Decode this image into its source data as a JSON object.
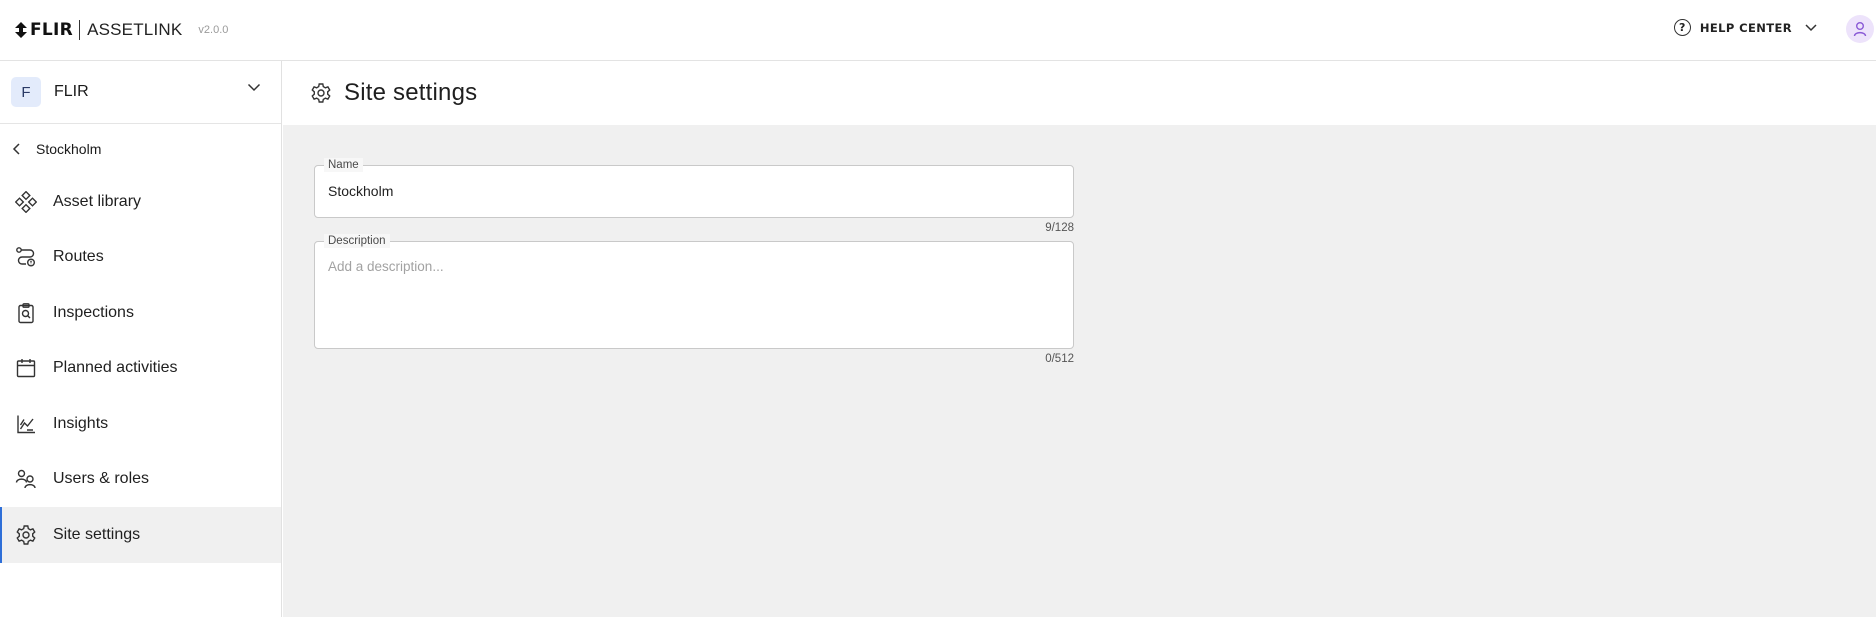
{
  "header": {
    "logo_text": "FLIR",
    "product_name": "ASSETLINK",
    "version": "v2.0.0",
    "help_label": "HELP CENTER"
  },
  "sidebar": {
    "org": {
      "initial": "F",
      "name": "FLIR"
    },
    "back_label": "Stockholm",
    "items": [
      {
        "label": "Asset library",
        "icon": "asset-library-icon",
        "active": false
      },
      {
        "label": "Routes",
        "icon": "routes-icon",
        "active": false
      },
      {
        "label": "Inspections",
        "icon": "inspections-icon",
        "active": false
      },
      {
        "label": "Planned activities",
        "icon": "calendar-icon",
        "active": false
      },
      {
        "label": "Insights",
        "icon": "insights-chart-icon",
        "active": false
      },
      {
        "label": "Users & roles",
        "icon": "users-icon",
        "active": false
      },
      {
        "label": "Site settings",
        "icon": "gear-icon",
        "active": true
      }
    ]
  },
  "page": {
    "title": "Site settings",
    "name_field": {
      "label": "Name",
      "value": "Stockholm",
      "counter": "9/128"
    },
    "description_field": {
      "label": "Description",
      "placeholder": "Add a description...",
      "counter": "0/512"
    }
  },
  "colors": {
    "accent": "#2f6fd8",
    "content_background": "#f0f0f0",
    "avatar_background": "#ede3fb",
    "org_badge_background": "#e3ebfb"
  }
}
